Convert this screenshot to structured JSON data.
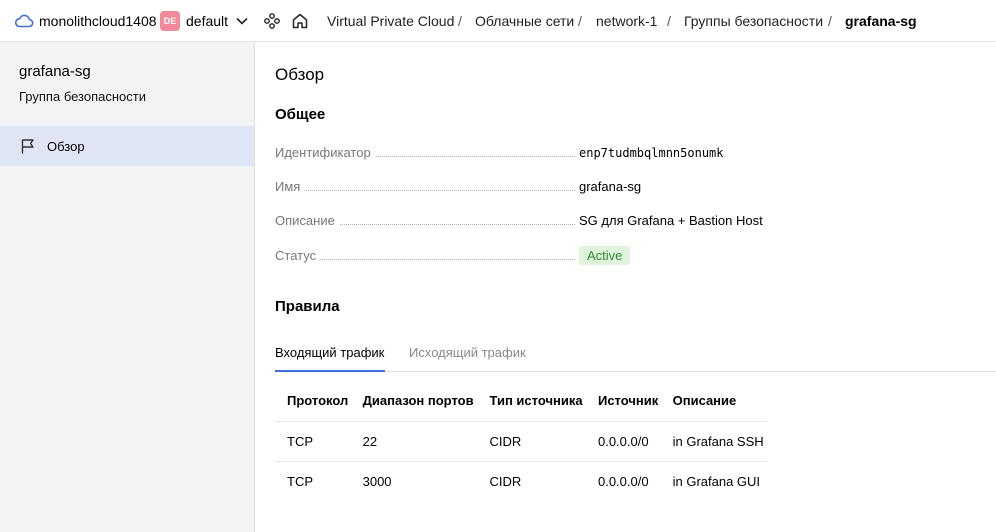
{
  "header": {
    "cloud_name": "monolithcloud1408",
    "region_badge": "DE",
    "folder_name": "default",
    "breadcrumbs": [
      "Virtual Private Cloud",
      "Облачные сети",
      "network-1",
      "Группы безопасности",
      "grafana-sg"
    ],
    "separator": "/"
  },
  "sidebar": {
    "title": "grafana-sg",
    "subtitle": "Группа безопасности",
    "items": [
      {
        "label": "Обзор",
        "icon": "flag-icon",
        "active": true
      }
    ]
  },
  "main": {
    "page_title": "Обзор",
    "general": {
      "title": "Общее",
      "rows": [
        {
          "label": "Идентификатор",
          "value": "enp7tudmbqlmnn5onumk"
        },
        {
          "label": "Имя",
          "value": "grafana-sg"
        },
        {
          "label": "Описание",
          "value": "SG для Grafana + Bastion Host"
        },
        {
          "label": "Статус",
          "value": "Active"
        }
      ]
    },
    "rules": {
      "title": "Правила",
      "tabs": [
        {
          "label": "Входящий трафик",
          "active": true
        },
        {
          "label": "Исходящий трафик",
          "active": false
        }
      ],
      "columns": [
        "Протокол",
        "Диапазон портов",
        "Тип источника",
        "Источник",
        "Описание"
      ],
      "rows": [
        [
          "TCP",
          "22",
          "CIDR",
          "0.0.0.0/0",
          "in Grafana SSH"
        ],
        [
          "TCP",
          "3000",
          "CIDR",
          "0.0.0.0/0",
          "in Grafana GUI"
        ]
      ]
    }
  },
  "colors": {
    "accent": "#3f6fdc",
    "region_badge": "#f08a9a",
    "status_bg": "#e0f4dd",
    "status_text": "#2f8a2f",
    "sidebar_bg": "#f2f3f5",
    "sidebar_active": "#dfe5f5"
  }
}
